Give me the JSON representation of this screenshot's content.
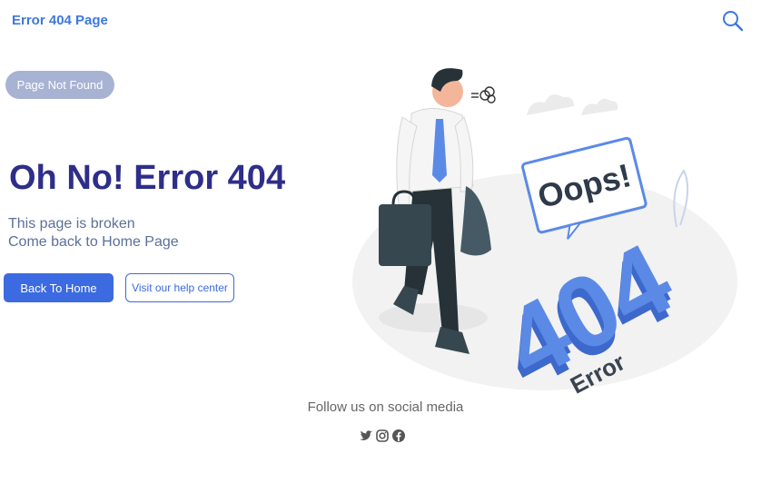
{
  "header": {
    "brand": "Error 404 Page",
    "search_icon": "search-icon"
  },
  "hero": {
    "badge": "Page Not Found",
    "headline": "Oh No! Error 404",
    "line1": "This page is broken",
    "line2": "Come back to Home Page",
    "primary_button": "Back To Home",
    "secondary_button": "Visit our help center"
  },
  "illustration": {
    "speech_text": "Oops!",
    "big_number": "404",
    "caption": "Error"
  },
  "footer": {
    "follow": "Follow us on social media",
    "icons": [
      "twitter-icon",
      "instagram-icon",
      "facebook-icon"
    ]
  },
  "colors": {
    "brand": "#3b78e0",
    "headline": "#2e2e8a",
    "button": "#3c6ae0",
    "badge": "#a8b2d3"
  }
}
